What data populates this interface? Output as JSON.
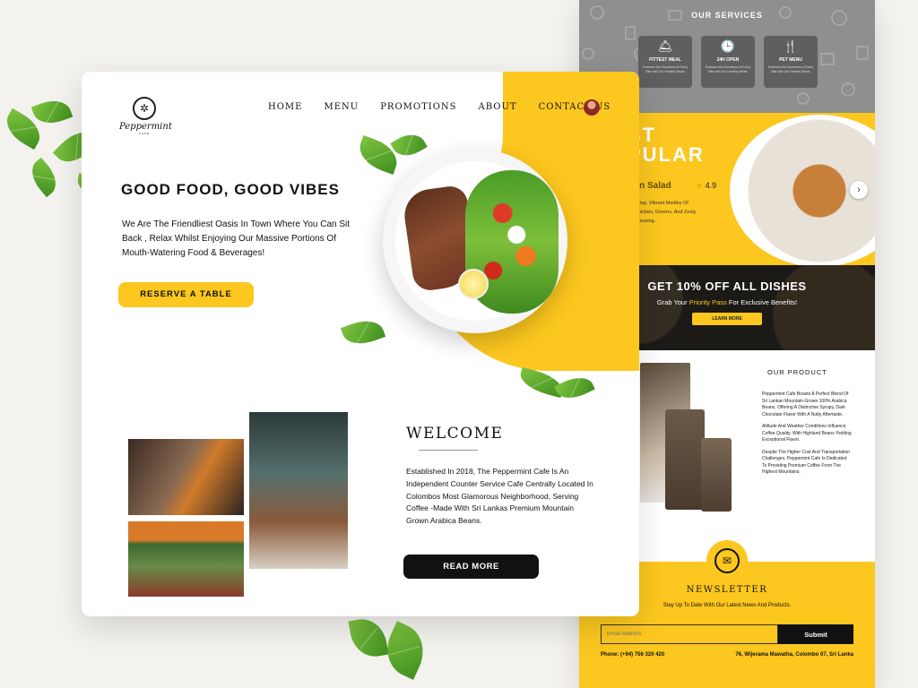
{
  "brand": {
    "name": "Peppermint",
    "tagline": "CAFE"
  },
  "nav": {
    "items": [
      "HOME",
      "MENU",
      "PROMOTIONS",
      "ABOUT",
      "CONTACT US"
    ]
  },
  "hero": {
    "title": "GOOD FOOD, GOOD VIBES",
    "subtitle": "We Are The Friendliest Oasis In Town Where You Can Sit Back , Relax Whilst Enjoying Our Massive Portions Of Mouth-Watering Food & Beverages!",
    "button": "RESERVE A TABLE"
  },
  "welcome": {
    "title": "WELCOME",
    "text": "Established In 2018, The Peppermint Cafe Is An Independent Counter Service Cafe Centrally Located In Colombos Most Glamorous Neighborhood, Serving Coffee -Made With Sri Lankas Premium Mountain Grown Arabica Beans.",
    "button": "READ MORE"
  },
  "services": {
    "title": "OUR SERVICES",
    "cards": [
      {
        "icon": "cloche-icon",
        "glyph": "🛎",
        "title": "FITTEST MEAL",
        "desc": "Embrace the Goodness of Every Bite with Our Healthy Meals"
      },
      {
        "icon": "clock-icon",
        "glyph": "🕒",
        "title": "24H OPEN",
        "desc": "Embrace the Goodness of Every Bite with Our Healthy Meals"
      },
      {
        "icon": "cutlery-icon",
        "glyph": "🍴",
        "title": "PET MENU",
        "desc": "Embrace the Goodness of Every Bite with Our Healthy Meals"
      }
    ]
  },
  "popular": {
    "title_line1": "ST",
    "title_line2": "PULAR",
    "dish": "ken Salad",
    "rating": "4.9",
    "desc": "Crisp, Vibrant Medley Of Chicken, Greens, And Zesty Dressing."
  },
  "promo": {
    "title": "GET 10% OFF ALL DISHES",
    "sub_prefix": "Grab Your ",
    "sub_highlight": "Priority Pass",
    "sub_suffix": " For Exclusive Benefits!",
    "button": "LEARN MORE"
  },
  "product": {
    "title": "OUR PRODUCT",
    "paragraphs": [
      "Peppermint Cafe Boasts A Perfect Blend Of Sri Lankan Mountain-Grown 100% Arabica Beans, Offering A Distinctive Syrupy, Dark Chocolate Flavor With A Nutty Aftertaste.",
      "Altitude And Weather Conditions Influence Coffee Quality, With Highland Beans Yielding Exceptional Flavor.",
      "Despite The Higher Cost And Transportation Challenges, Peppermint Cafe Is Dedicated To Providing Premium Coffee From The Highest Mountains."
    ]
  },
  "newsletter": {
    "title": "NEWSLETTER",
    "sub": "Stay Up To Date With Our Latest News And Products.",
    "placeholder": "Email Address",
    "button": "Submit",
    "phone": "Phone: (+94) 756 320 420",
    "address": "76, Wijerama Mawatha, Colombo 07, Sri Lanka"
  },
  "colors": {
    "accent": "#fcc71e",
    "dark": "#111111",
    "grey": "#8f8f8f"
  }
}
